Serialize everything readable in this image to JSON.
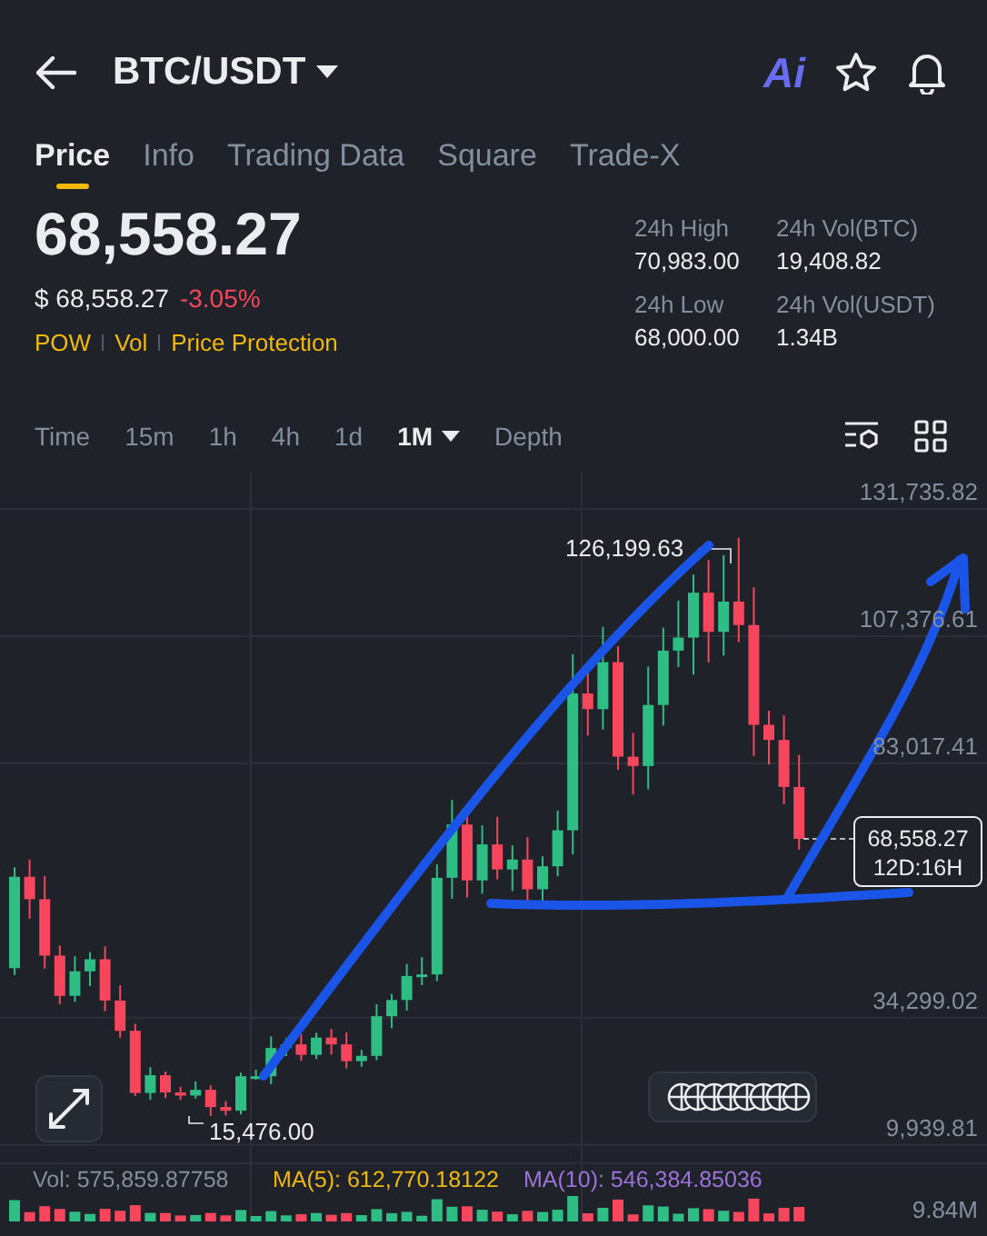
{
  "header": {
    "pair": "BTC/USDT",
    "ai_label": "Ai"
  },
  "tabs": [
    {
      "label": "Price",
      "selected": true
    },
    {
      "label": "Info",
      "selected": false
    },
    {
      "label": "Trading Data",
      "selected": false
    },
    {
      "label": "Square",
      "selected": false
    },
    {
      "label": "Trade-X",
      "selected": false
    }
  ],
  "price": {
    "last": "68,558.27",
    "usd": "$ 68,558.27",
    "change": "-3.05%",
    "tags": [
      "POW",
      "Vol",
      "Price Protection"
    ]
  },
  "stats": [
    {
      "label": "24h High",
      "value": "70,983.00"
    },
    {
      "label": "24h Vol(BTC)",
      "value": "19,408.82"
    },
    {
      "label": "24h Low",
      "value": "68,000.00"
    },
    {
      "label": "24h Vol(USDT)",
      "value": "1.34B"
    }
  ],
  "intervals": [
    {
      "label": "Time",
      "selected": false,
      "kind": "plain"
    },
    {
      "label": "15m",
      "selected": false,
      "kind": "plain"
    },
    {
      "label": "1h",
      "selected": false,
      "kind": "plain"
    },
    {
      "label": "4h",
      "selected": false,
      "kind": "plain"
    },
    {
      "label": "1d",
      "selected": false,
      "kind": "plain"
    },
    {
      "label": "1M",
      "selected": true,
      "kind": "dropdown"
    },
    {
      "label": "Depth",
      "selected": false,
      "kind": "plain"
    }
  ],
  "chart": {
    "y_axis_labels": [
      "131,735.82",
      "107,376.61",
      "83,017.41",
      "34,299.02",
      "9,939.81"
    ],
    "high_label": "126,199.63",
    "low_label": "15,476.00",
    "current_price": "68,558.27",
    "countdown": "12D:16H",
    "volume_axis_label": "9.84M"
  },
  "indicators": [
    {
      "text": "Vol: 575,859.87758",
      "color": "#848e9c"
    },
    {
      "text": "MA(5): 612,770.18122",
      "color": "#f0b90b"
    },
    {
      "text": "MA(10): 546,384.85036",
      "color": "#9b73d9"
    }
  ]
}
